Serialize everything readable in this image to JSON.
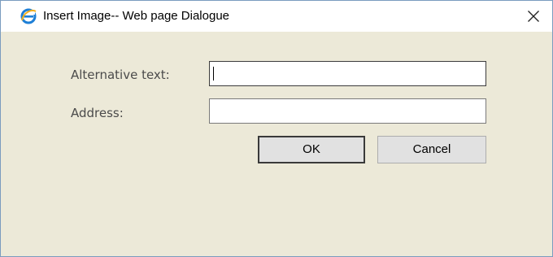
{
  "window": {
    "title": "Insert Image-- Web page Dialogue",
    "icon": "internet-explorer-icon",
    "close_icon": "close-icon"
  },
  "form": {
    "alt_text_label": "Alternative text:",
    "alt_text_value": "",
    "address_label": "Address:",
    "address_value": ""
  },
  "buttons": {
    "ok_label": "OK",
    "cancel_label": "Cancel"
  },
  "colors": {
    "dialog_background": "#ece9d8",
    "ie_icon_blue": "#1e7fd6"
  }
}
